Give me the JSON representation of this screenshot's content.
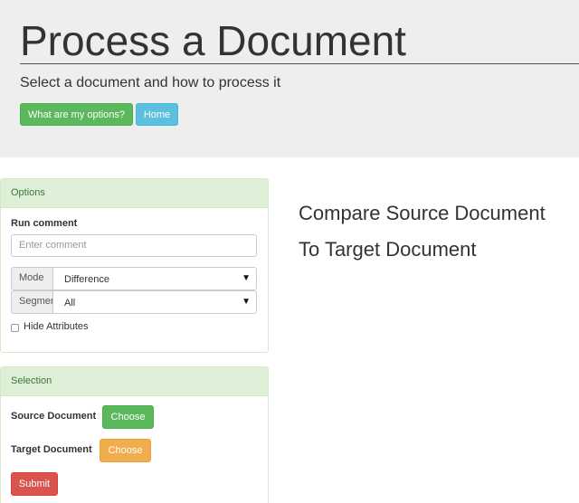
{
  "header": {
    "title": "Process a Document",
    "subtitle": "Select a document and how to process it",
    "options_button": "What are my options?",
    "home_button": "Home"
  },
  "options_panel": {
    "heading": "Options",
    "run_comment_label": "Run comment",
    "comment_placeholder": "Enter comment",
    "mode_label": "Mode",
    "mode_value": "Difference",
    "segment_label": "Segment",
    "segment_value": "All",
    "hide_attributes_label": "Hide Attributes",
    "hide_attributes_checked": false
  },
  "selection_panel": {
    "heading": "Selection",
    "source_label": "Source Document",
    "source_button": "Choose",
    "target_label": "Target Document",
    "target_button": "Choose",
    "submit_button": "Submit"
  },
  "main": {
    "heading_line1": "Compare Source Document",
    "heading_line2": "To Target Document"
  },
  "colors": {
    "success": "#5cb85c",
    "info": "#5bc0de",
    "warning": "#f0ad4e",
    "danger": "#d9534f",
    "panel_heading": "#dff0d8"
  }
}
